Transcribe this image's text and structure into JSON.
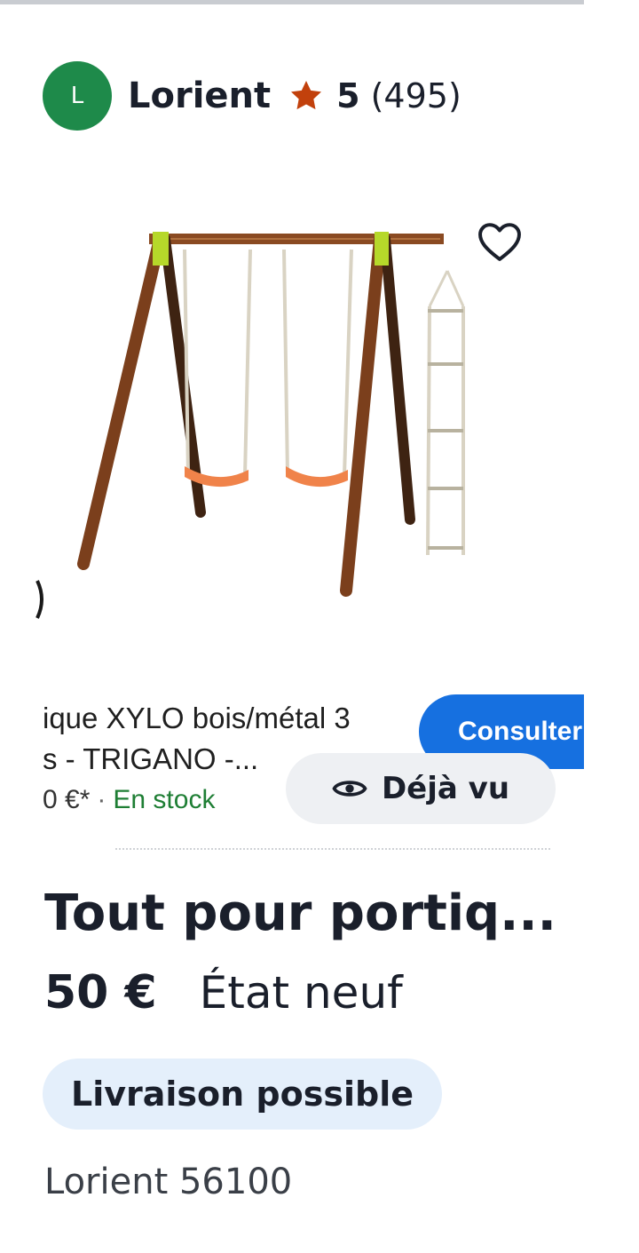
{
  "seller": {
    "avatar_initial": "L",
    "name": "Lorient",
    "rating": "5",
    "review_count": "(495)",
    "avatar_color": "#1e8a4a",
    "star_color": "#c2410c"
  },
  "photo": {
    "favorite_icon": "heart-outline-icon",
    "product_title_lines": [
      "ique XYLO bois/métal 3",
      "s - TRIGANO -..."
    ],
    "price_text": "0 €*",
    "separator": "·",
    "stock_text": "En stock",
    "consult_label": "Consulter",
    "seen_label": "Déjà vu",
    "seen_icon": "eye-icon"
  },
  "listing": {
    "title": "Tout pour portiq...",
    "price": "50 €",
    "condition": "État neuf",
    "delivery_badge": "Livraison possible",
    "location": "Lorient 56100"
  },
  "colors": {
    "primary_blue": "#1670e0",
    "badge_bg": "#e4effb",
    "text_dark": "#1a1f2b"
  }
}
